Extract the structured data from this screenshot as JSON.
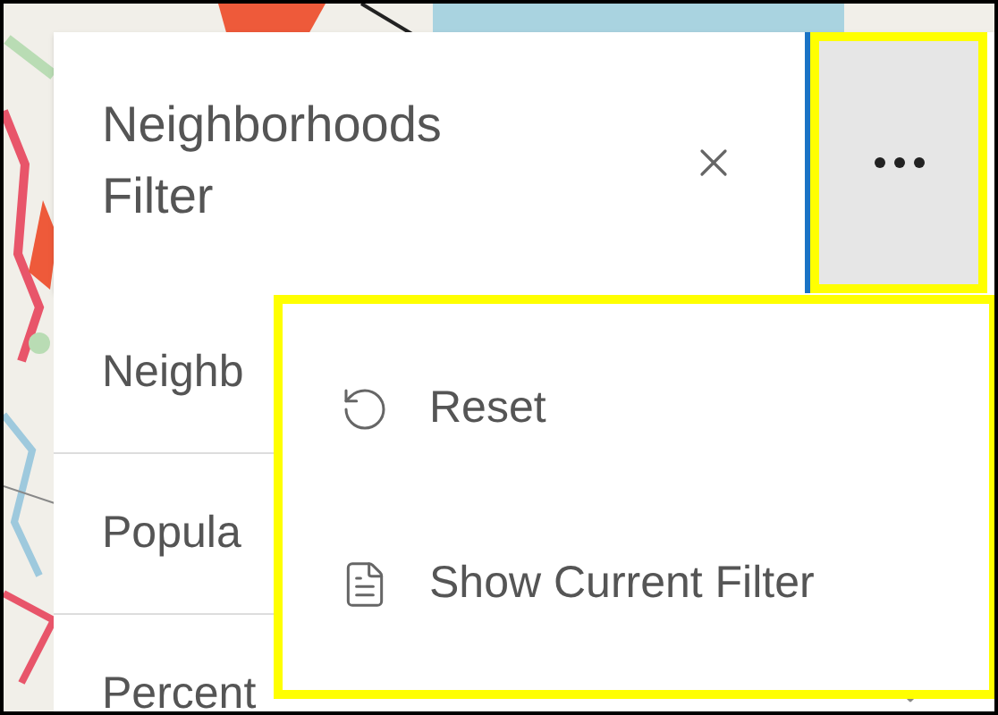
{
  "panel": {
    "title": "Neighborhoods Filter"
  },
  "filters": [
    {
      "label": "Neighb"
    },
    {
      "label": "Popula"
    },
    {
      "label": "Percent"
    }
  ],
  "menu": {
    "items": [
      {
        "kind": "reset",
        "label": "Reset"
      },
      {
        "kind": "document",
        "label": "Show Current Filter"
      }
    ]
  }
}
